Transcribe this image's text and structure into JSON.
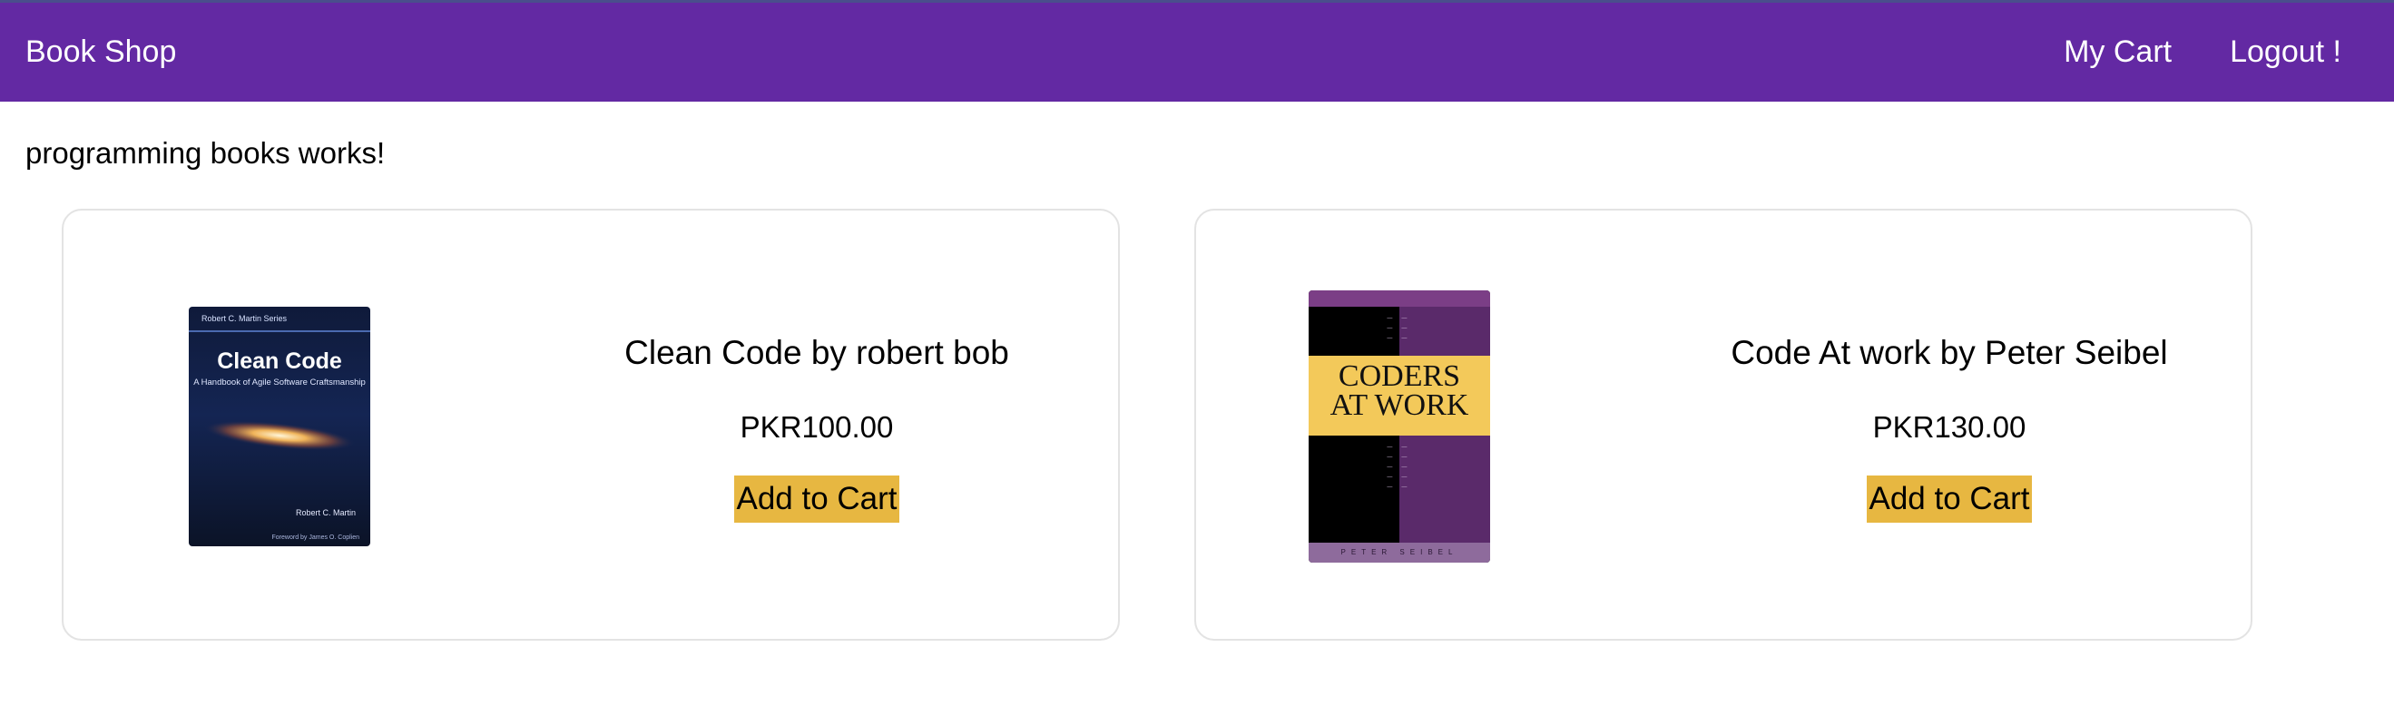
{
  "navbar": {
    "brand": "Book Shop",
    "links": [
      {
        "label": "My Cart"
      },
      {
        "label": "Logout !"
      }
    ],
    "background": "#6329a3"
  },
  "page": {
    "heading": "programming books works!"
  },
  "products": [
    {
      "title": "Clean Code by robert bob",
      "price": "PKR100.00",
      "button_label": "Add to Cart",
      "cover": {
        "series": "Robert C. Martin Series",
        "title": "Clean Code",
        "subtitle": "A Handbook of Agile Software Craftsmanship",
        "author": "Robert C. Martin",
        "foreword": "Foreword by James O. Coplien"
      }
    },
    {
      "title": "Code At work by Peter Seibel",
      "price": "PKR130.00",
      "button_label": "Add to Cart",
      "cover": {
        "title_line1": "CODERS",
        "title_line2": "AT WORK",
        "author": "PETER SEIBEL"
      }
    }
  ],
  "colors": {
    "button": "#e7b741",
    "card_border": "#e3e3e3"
  }
}
